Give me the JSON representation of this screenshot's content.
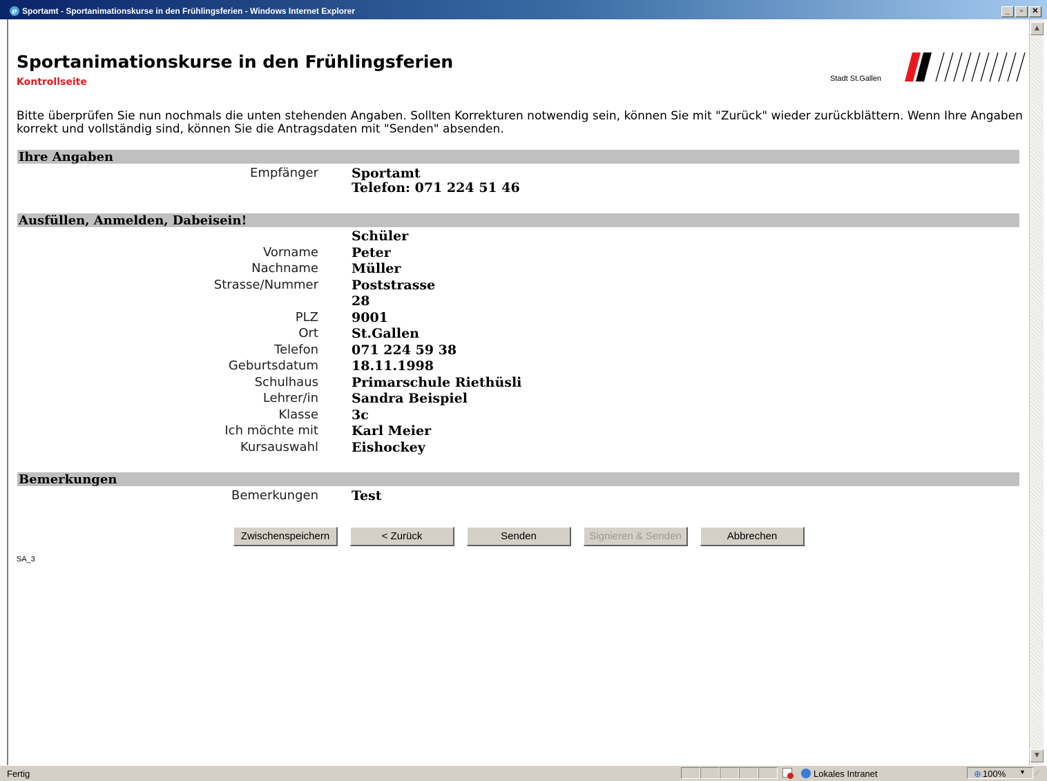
{
  "window": {
    "title": "Sportamt - Sportanimationskurse in den Frühlingsferien - Windows Internet Explorer",
    "minimize": "_",
    "maximize": "▫",
    "close": "✕"
  },
  "header": {
    "title": "Sportanimationskurse in den Frühlingsferien",
    "subtitle": "Kontrollseite",
    "logo_text": "Stadt St.Gallen"
  },
  "intro": "Bitte überprüfen Sie nun nochmals die unten stehenden Angaben. Sollten Korrekturen notwendig sein, können Sie mit \"Zurück\" wieder zurückblättern. Wenn Ihre Angaben korrekt und vollständig sind, können Sie die Antragsdaten mit \"Senden\" absenden.",
  "sections": {
    "ihre_angaben": {
      "title": "Ihre Angaben",
      "recipient_label": "Empfänger",
      "recipient_name": "Sportamt",
      "recipient_phone": "Telefon: 071 224 51 46"
    },
    "ausfuellen": {
      "title": "Ausfüllen, Anmelden, Dabeisein!",
      "type_value": "Schüler",
      "fields": [
        {
          "label": "Vorname",
          "value": "Peter"
        },
        {
          "label": "Nachname",
          "value": "Müller"
        },
        {
          "label": "Strasse/Nummer",
          "value": "Poststrasse"
        },
        {
          "label": "",
          "value": "28"
        },
        {
          "label": "PLZ",
          "value": "9001"
        },
        {
          "label": "Ort",
          "value": "St.Gallen"
        },
        {
          "label": "Telefon",
          "value": "071 224 59 38"
        },
        {
          "label": "Geburtsdatum",
          "value": "18.11.1998"
        },
        {
          "label": "Schulhaus",
          "value": "Primarschule Riethüsli"
        },
        {
          "label": "Lehrer/in",
          "value": "Sandra Beispiel"
        },
        {
          "label": "Klasse",
          "value": "3c"
        },
        {
          "label": "Ich möchte mit",
          "value": "Karl Meier"
        },
        {
          "label": "Kursauswahl",
          "value": "Eishockey"
        }
      ]
    },
    "bemerkungen": {
      "title": "Bemerkungen",
      "label": "Bemerkungen",
      "value": "Test"
    }
  },
  "buttons": {
    "save": "Zwischenspeichern",
    "back": "< Zurück",
    "send": "Senden",
    "sign_send": "Signieren & Senden",
    "cancel": "Abbrechen"
  },
  "page_code": "SA_3",
  "statusbar": {
    "status": "Fertig",
    "zone": "Lokales Intranet",
    "zoom": "100%"
  },
  "colors": {
    "accent_red": "#e8191e",
    "section_bar": "#c0c0c0"
  }
}
